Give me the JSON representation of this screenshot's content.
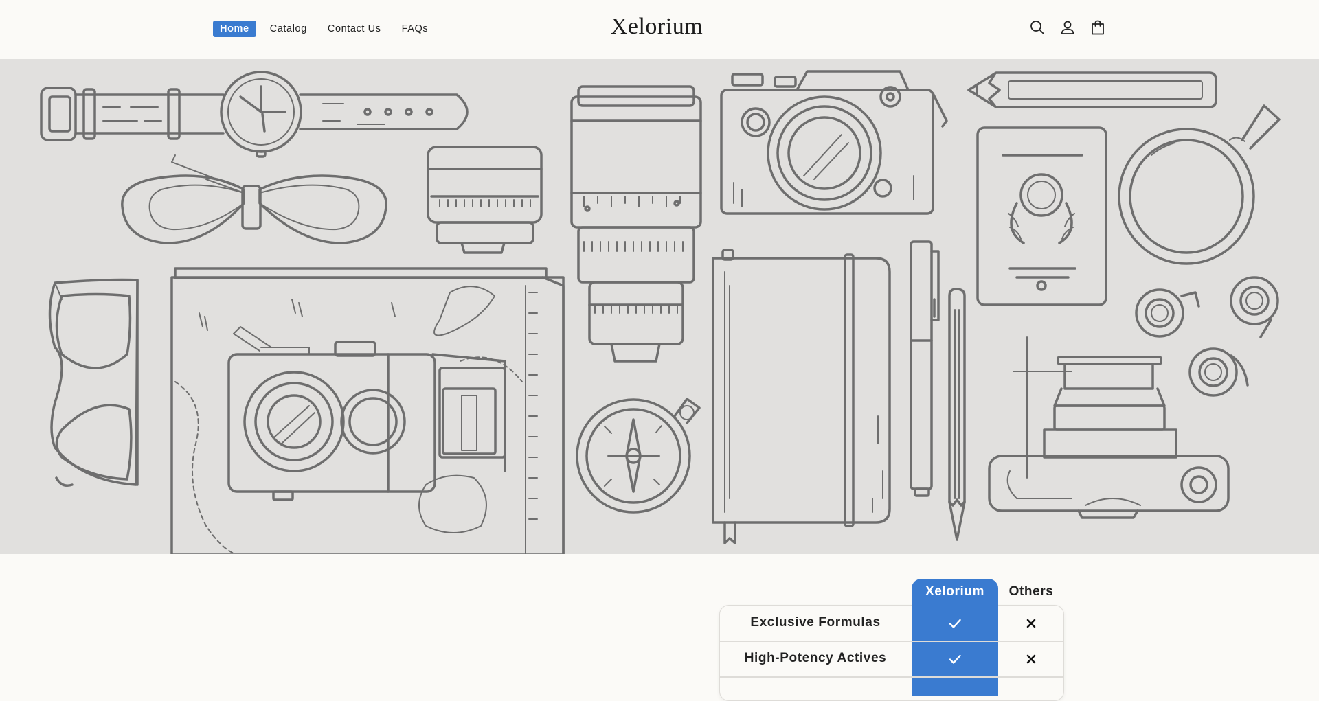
{
  "header": {
    "nav": [
      {
        "label": "Home",
        "active": true
      },
      {
        "label": "Catalog",
        "active": false
      },
      {
        "label": "Contact Us",
        "active": false
      },
      {
        "label": "FAQs",
        "active": false
      }
    ],
    "logo": "Xelorium",
    "icons": [
      "search-icon",
      "account-icon",
      "cart-icon"
    ]
  },
  "hero": {
    "illustration": [
      "wristwatch",
      "bow-tie",
      "lens-cap",
      "zoom-lens",
      "camera",
      "pencil",
      "passport",
      "magnifying-glass",
      "sunglasses",
      "map",
      "vintage-camera",
      "compass",
      "notebook",
      "pen",
      "pencil",
      "film-rolls",
      "instant-camera"
    ]
  },
  "comparison": {
    "columns": {
      "brand": "Xelorium",
      "others": "Others"
    },
    "rows": [
      {
        "label": "Exclusive Formulas",
        "brand": true,
        "others": false
      },
      {
        "label": "High-Potency Actives",
        "brand": true,
        "others": false
      }
    ]
  },
  "colors": {
    "accent": "#3a7bd0",
    "background": "#fbfaf7",
    "hero_bg": "#e1e0de",
    "line_art": "#6e6e6e"
  }
}
